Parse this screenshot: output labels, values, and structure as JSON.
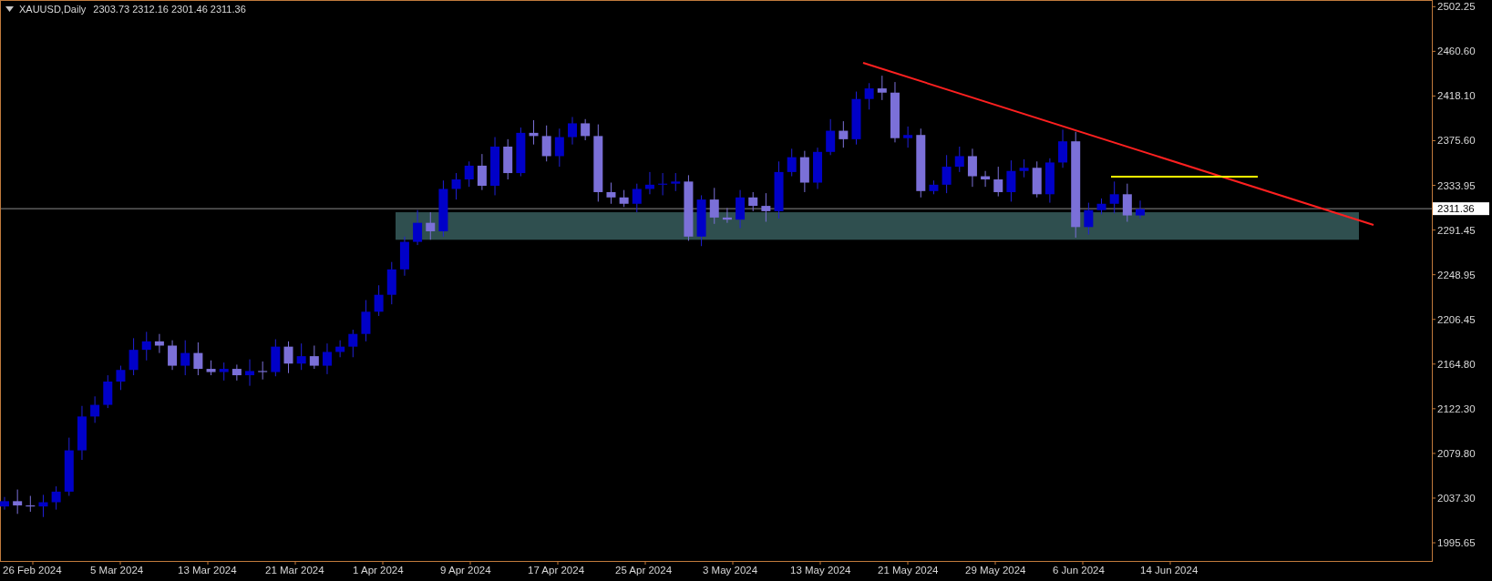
{
  "header": {
    "symbol": "XAUUSD,Daily",
    "ohlc": "2303.73 2312.16 2301.46 2311.36"
  },
  "price_axis": {
    "labels": [
      "2502.25",
      "2460.60",
      "2418.10",
      "2375.60",
      "2333.95",
      "2291.45",
      "2248.95",
      "2206.45",
      "2164.80",
      "2122.30",
      "2079.80",
      "2037.30",
      "1995.65"
    ],
    "current_price": "2311.36"
  },
  "time_axis": {
    "labels": [
      "26 Feb 2024",
      "5 Mar 2024",
      "13 Mar 2024",
      "21 Mar 2024",
      "1 Apr 2024",
      "9 Apr 2024",
      "17 Apr 2024",
      "25 Apr 2024",
      "3 May 2024",
      "13 May 2024",
      "21 May 2024",
      "29 May 2024",
      "6 Jun 2024",
      "14 Jun 2024"
    ]
  }
}
